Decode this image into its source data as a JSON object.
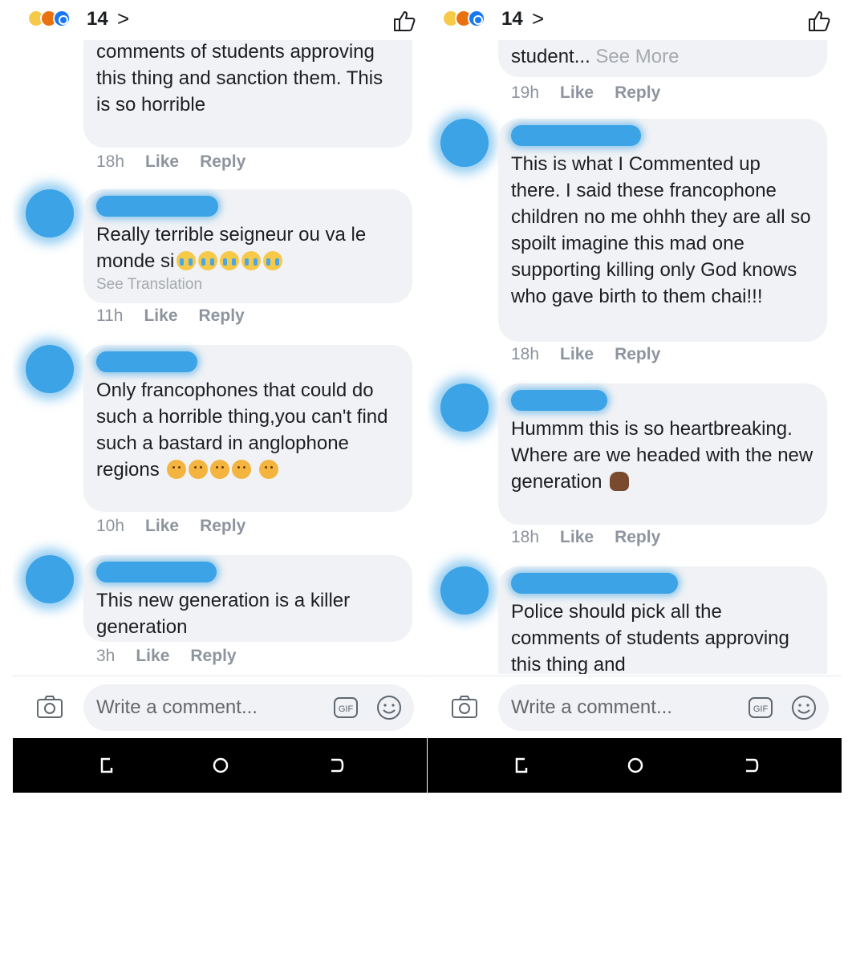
{
  "header": {
    "reaction_count": "14",
    "chevron": ">",
    "reaction_icons": [
      "sad-reaction-icon",
      "angry-reaction-icon",
      "like-reaction-icon"
    ]
  },
  "composer": {
    "placeholder": "Write a comment...",
    "gif_label": "GIF"
  },
  "left": {
    "comments": [
      {
        "partial_top": true,
        "text": "comments of students approving this thing and sanction them. This is so horrible",
        "time": "18h",
        "like": "Like",
        "reply": "Reply"
      },
      {
        "text": "Really terrible seigneur ou va le monde si",
        "emoji": [
          "cry",
          "cry",
          "cry",
          "cry",
          "cry"
        ],
        "see_translation": "See Translation",
        "time": "11h",
        "like": "Like",
        "reply": "Reply"
      },
      {
        "text": "Only francophones that could do such a horrible thing,you can't find such a bastard in anglophone regions",
        "emoji": [
          "sad",
          "sad",
          "sad",
          "sad",
          "sad"
        ],
        "time": "10h",
        "like": "Like",
        "reply": "Reply"
      },
      {
        "text": "This new generation is a killer generation",
        "time": "3h",
        "like": "Like",
        "reply": "Reply"
      }
    ]
  },
  "right": {
    "comments": [
      {
        "partial_top": true,
        "text": "student...",
        "see_more": "See More",
        "time": "19h",
        "like": "Like",
        "reply": "Reply"
      },
      {
        "text": "This is what I Commented up there. I said these francophone children no me ohhh they are all so spoilt imagine this mad one supporting killing only God knows who gave birth to them chai!!!",
        "time": "18h",
        "like": "Like",
        "reply": "Reply"
      },
      {
        "text": "Hummm this is so heartbreaking. Where are we headed with the new generation",
        "emoji": [
          "woman"
        ],
        "time": "18h",
        "like": "Like",
        "reply": "Reply"
      },
      {
        "text": "Police should pick all the comments of students approving this thing and",
        "partial_bottom": true
      }
    ]
  },
  "colors": {
    "bubble": "#f0f2f5",
    "meta": "#8d949e",
    "redaction": "#3ba3e6",
    "navbar": "#000000",
    "like_blue": "#1877f2"
  }
}
